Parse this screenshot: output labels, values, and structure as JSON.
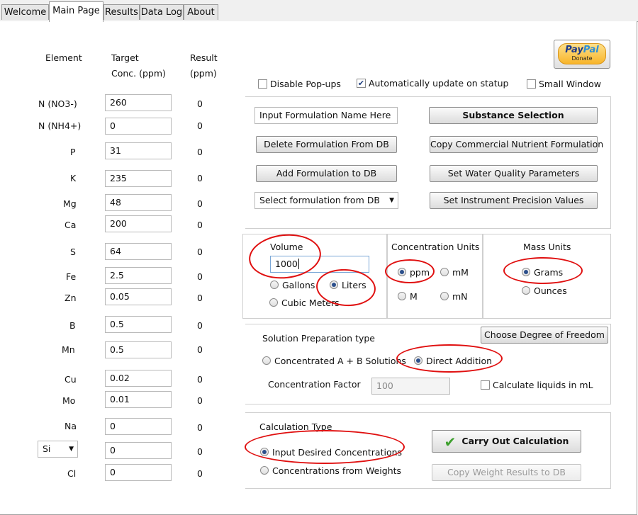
{
  "tabs": [
    "Welcome",
    "Main Page",
    "Results",
    "Data Log",
    "About"
  ],
  "headers": {
    "element": "Element",
    "target1": "Target",
    "target2": "Conc. (ppm)",
    "result1": "Result",
    "result2": "(ppm)"
  },
  "elements": [
    {
      "name": "N (NO3-)",
      "value": "260",
      "result": "0"
    },
    {
      "name": "N (NH4+)",
      "value": "0",
      "result": "0"
    },
    {
      "name": "P",
      "value": "31",
      "result": "0"
    },
    {
      "name": "K",
      "value": "235",
      "result": "0"
    },
    {
      "name": "Mg",
      "value": "48",
      "result": "0"
    },
    {
      "name": "Ca",
      "value": "200",
      "result": "0"
    },
    {
      "name": "S",
      "value": "64",
      "result": "0"
    },
    {
      "name": "Fe",
      "value": "2.5",
      "result": "0"
    },
    {
      "name": "Zn",
      "value": "0.05",
      "result": "0"
    },
    {
      "name": "B",
      "value": "0.5",
      "result": "0"
    },
    {
      "name": "Mn",
      "value": "0.5",
      "result": "0"
    },
    {
      "name": "Cu",
      "value": "0.02",
      "result": "0"
    },
    {
      "name": "Mo",
      "value": "0.01",
      "result": "0"
    },
    {
      "name": "Na",
      "value": "0",
      "result": "0"
    },
    {
      "name": "Si",
      "value": "0",
      "result": "0"
    },
    {
      "name": "Cl",
      "value": "0",
      "result": "0"
    }
  ],
  "paypal": {
    "brand1": "Pay",
    "brand2": "Pal",
    "sub": "Donate"
  },
  "options": {
    "disable_popups": "Disable Pop-ups",
    "auto_update": "Automatically update on statup",
    "small_window": "Small Window"
  },
  "formulation": {
    "name_input": "Input Formulation Name Here",
    "substance_selection": "Substance Selection",
    "delete": "Delete Formulation From DB",
    "copy_commercial": "Copy Commercial Nutrient Formulation",
    "add": "Add Formulation to DB",
    "water_quality": "Set Water Quality Parameters",
    "select_db": "Select formulation from DB",
    "precision": "Set Instrument Precision Values"
  },
  "volume": {
    "label": "Volume",
    "value": "1000",
    "gallons": "Gallons",
    "liters": "Liters",
    "cubic": "Cubic Meters"
  },
  "conc_units": {
    "label": "Concentration Units",
    "ppm": "ppm",
    "mM": "mM",
    "M": "M",
    "mN": "mN"
  },
  "mass_units": {
    "label": "Mass Units",
    "grams": "Grams",
    "ounces": "Ounces"
  },
  "prep": {
    "label": "Solution Preparation type",
    "degree_btn": "Choose Degree of Freedom",
    "concentrated": "Concentrated A + B Solutions",
    "direct": "Direct Addition",
    "factor_label": "Concentration Factor",
    "factor_value": "100",
    "liquids_ml": "Calculate liquids in mL"
  },
  "calc": {
    "label": "Calculation Type",
    "desired": "Input Desired Concentrations",
    "weights": "Concentrations from  Weights",
    "carry_out": "Carry Out Calculation",
    "copy_weight": "Copy Weight Results to DB"
  },
  "colors": {
    "annotation": "#e01010",
    "paypal_blue": "#1d3a8a",
    "paypal_light": "#2d8fd8",
    "paypal_gold": "#fbc43c"
  }
}
